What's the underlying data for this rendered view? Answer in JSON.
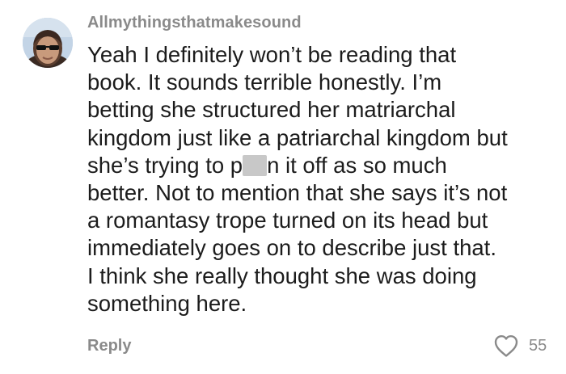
{
  "comment": {
    "username": "Allmythingsthatmakesound",
    "body_lines": [
      "Yeah I definitely won’t be reading that",
      "book. It sounds terrible honestly. I’m",
      "betting she structured her matriarchal",
      "kingdom just like a patriarchal kingdom but"
    ],
    "body_line5_pre": "she’s trying to p",
    "body_line5_post": "n it off as so much",
    "body_lines_rest": [
      "better. Not to mention that she says it’s not",
      "a romantasy trope turned on its head but",
      "immediately goes on to describe just that.",
      "I think she really thought she was doing",
      "something here."
    ],
    "reply_label": "Reply",
    "like_count": "55"
  },
  "icons": {
    "avatar": "user-avatar-photo",
    "like": "heart-outline-icon"
  },
  "colors": {
    "meta_text": "#8a8a8a",
    "body_text": "#1c1c1c",
    "background": "#ffffff"
  }
}
